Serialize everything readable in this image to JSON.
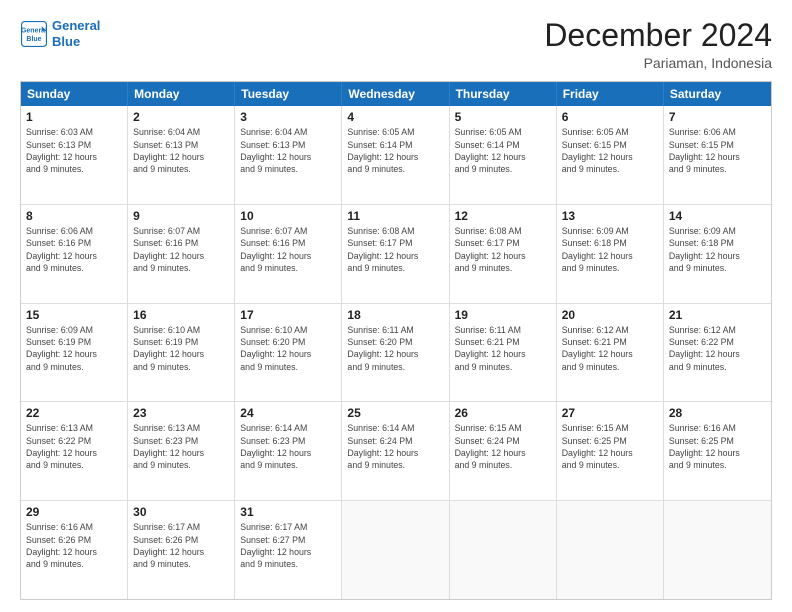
{
  "header": {
    "logo_line1": "General",
    "logo_line2": "Blue",
    "month": "December 2024",
    "location": "Pariaman, Indonesia"
  },
  "weekdays": [
    "Sunday",
    "Monday",
    "Tuesday",
    "Wednesday",
    "Thursday",
    "Friday",
    "Saturday"
  ],
  "rows": [
    [
      {
        "day": "1",
        "info": "Sunrise: 6:03 AM\nSunset: 6:13 PM\nDaylight: 12 hours\nand 9 minutes."
      },
      {
        "day": "2",
        "info": "Sunrise: 6:04 AM\nSunset: 6:13 PM\nDaylight: 12 hours\nand 9 minutes."
      },
      {
        "day": "3",
        "info": "Sunrise: 6:04 AM\nSunset: 6:13 PM\nDaylight: 12 hours\nand 9 minutes."
      },
      {
        "day": "4",
        "info": "Sunrise: 6:05 AM\nSunset: 6:14 PM\nDaylight: 12 hours\nand 9 minutes."
      },
      {
        "day": "5",
        "info": "Sunrise: 6:05 AM\nSunset: 6:14 PM\nDaylight: 12 hours\nand 9 minutes."
      },
      {
        "day": "6",
        "info": "Sunrise: 6:05 AM\nSunset: 6:15 PM\nDaylight: 12 hours\nand 9 minutes."
      },
      {
        "day": "7",
        "info": "Sunrise: 6:06 AM\nSunset: 6:15 PM\nDaylight: 12 hours\nand 9 minutes."
      }
    ],
    [
      {
        "day": "8",
        "info": "Sunrise: 6:06 AM\nSunset: 6:16 PM\nDaylight: 12 hours\nand 9 minutes."
      },
      {
        "day": "9",
        "info": "Sunrise: 6:07 AM\nSunset: 6:16 PM\nDaylight: 12 hours\nand 9 minutes."
      },
      {
        "day": "10",
        "info": "Sunrise: 6:07 AM\nSunset: 6:16 PM\nDaylight: 12 hours\nand 9 minutes."
      },
      {
        "day": "11",
        "info": "Sunrise: 6:08 AM\nSunset: 6:17 PM\nDaylight: 12 hours\nand 9 minutes."
      },
      {
        "day": "12",
        "info": "Sunrise: 6:08 AM\nSunset: 6:17 PM\nDaylight: 12 hours\nand 9 minutes."
      },
      {
        "day": "13",
        "info": "Sunrise: 6:09 AM\nSunset: 6:18 PM\nDaylight: 12 hours\nand 9 minutes."
      },
      {
        "day": "14",
        "info": "Sunrise: 6:09 AM\nSunset: 6:18 PM\nDaylight: 12 hours\nand 9 minutes."
      }
    ],
    [
      {
        "day": "15",
        "info": "Sunrise: 6:09 AM\nSunset: 6:19 PM\nDaylight: 12 hours\nand 9 minutes."
      },
      {
        "day": "16",
        "info": "Sunrise: 6:10 AM\nSunset: 6:19 PM\nDaylight: 12 hours\nand 9 minutes."
      },
      {
        "day": "17",
        "info": "Sunrise: 6:10 AM\nSunset: 6:20 PM\nDaylight: 12 hours\nand 9 minutes."
      },
      {
        "day": "18",
        "info": "Sunrise: 6:11 AM\nSunset: 6:20 PM\nDaylight: 12 hours\nand 9 minutes."
      },
      {
        "day": "19",
        "info": "Sunrise: 6:11 AM\nSunset: 6:21 PM\nDaylight: 12 hours\nand 9 minutes."
      },
      {
        "day": "20",
        "info": "Sunrise: 6:12 AM\nSunset: 6:21 PM\nDaylight: 12 hours\nand 9 minutes."
      },
      {
        "day": "21",
        "info": "Sunrise: 6:12 AM\nSunset: 6:22 PM\nDaylight: 12 hours\nand 9 minutes."
      }
    ],
    [
      {
        "day": "22",
        "info": "Sunrise: 6:13 AM\nSunset: 6:22 PM\nDaylight: 12 hours\nand 9 minutes."
      },
      {
        "day": "23",
        "info": "Sunrise: 6:13 AM\nSunset: 6:23 PM\nDaylight: 12 hours\nand 9 minutes."
      },
      {
        "day": "24",
        "info": "Sunrise: 6:14 AM\nSunset: 6:23 PM\nDaylight: 12 hours\nand 9 minutes."
      },
      {
        "day": "25",
        "info": "Sunrise: 6:14 AM\nSunset: 6:24 PM\nDaylight: 12 hours\nand 9 minutes."
      },
      {
        "day": "26",
        "info": "Sunrise: 6:15 AM\nSunset: 6:24 PM\nDaylight: 12 hours\nand 9 minutes."
      },
      {
        "day": "27",
        "info": "Sunrise: 6:15 AM\nSunset: 6:25 PM\nDaylight: 12 hours\nand 9 minutes."
      },
      {
        "day": "28",
        "info": "Sunrise: 6:16 AM\nSunset: 6:25 PM\nDaylight: 12 hours\nand 9 minutes."
      }
    ],
    [
      {
        "day": "29",
        "info": "Sunrise: 6:16 AM\nSunset: 6:26 PM\nDaylight: 12 hours\nand 9 minutes."
      },
      {
        "day": "30",
        "info": "Sunrise: 6:17 AM\nSunset: 6:26 PM\nDaylight: 12 hours\nand 9 minutes."
      },
      {
        "day": "31",
        "info": "Sunrise: 6:17 AM\nSunset: 6:27 PM\nDaylight: 12 hours\nand 9 minutes."
      },
      {
        "day": "",
        "info": ""
      },
      {
        "day": "",
        "info": ""
      },
      {
        "day": "",
        "info": ""
      },
      {
        "day": "",
        "info": ""
      }
    ]
  ]
}
